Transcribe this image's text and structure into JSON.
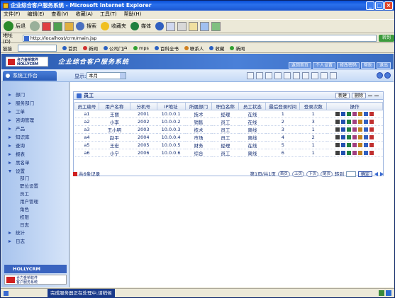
{
  "window": {
    "title": "企业综合客户服务系统 - Microsoft Internet Explorer"
  },
  "menu": [
    "文件(F)",
    "编辑(E)",
    "查看(V)",
    "收藏(A)",
    "工具(T)",
    "帮助(H)"
  ],
  "toolbar": {
    "back": "后退",
    "search": "搜索",
    "favorites": "收藏夹",
    "media": "媒体"
  },
  "address": {
    "label": "地址(D)",
    "value": "http://localhost/crm/main.jsp",
    "go": "转到"
  },
  "links": {
    "label": "链接",
    "items": [
      "首页",
      "新闻",
      "公司门户",
      "mps",
      "百科全书",
      "联系人",
      "收藏",
      "新闻"
    ]
  },
  "app": {
    "logo_line1": "合力金桥软件",
    "logo_line2": "HOLLYCRM",
    "title": "企业综合客户服务系统",
    "header_buttons": [
      "返回首页",
      "个人设置",
      "修改密码",
      "帮助",
      "退出"
    ]
  },
  "subheader": {
    "side_tab": "系统工作台",
    "display_label": "显示:",
    "display_value": "本月"
  },
  "sidebar": {
    "items": [
      {
        "label": "部门",
        "open": false
      },
      {
        "label": "服务部门",
        "open": false
      },
      {
        "label": "工单",
        "open": false
      },
      {
        "label": "咨询管理",
        "open": false
      },
      {
        "label": "产品",
        "open": false
      },
      {
        "label": "知识库",
        "open": false
      },
      {
        "label": "查询",
        "open": false
      },
      {
        "label": "报表",
        "open": false
      },
      {
        "label": "黑名单",
        "open": false
      },
      {
        "label": "设置",
        "open": true
      }
    ],
    "subitems": [
      "部门",
      "职位设置",
      "员工",
      "用户管理",
      "角色",
      "权限",
      "日志"
    ],
    "after_items": [
      {
        "label": "统计",
        "open": false
      },
      {
        "label": "日志",
        "open": false
      }
    ],
    "bottom_logo": "HOLLYCRM",
    "bottom_text1": "合力金桥软件",
    "bottom_text2": "客户服务系统"
  },
  "panel": {
    "title": "员工",
    "buttons": [
      "新建",
      "删除"
    ]
  },
  "table": {
    "columns": [
      "员工编号",
      "用户名称",
      "分机号",
      "IP地址",
      "所属部门",
      "职位名称",
      "员工状态",
      "最后登录时间",
      "登录次数",
      "操作"
    ],
    "rows": [
      [
        "a1",
        "王丽",
        "2001",
        "10.0.0.1",
        "技术",
        "经理",
        "在线",
        "1",
        "1"
      ],
      [
        "a2",
        "小李",
        "2002",
        "10.0.0.2",
        "销售",
        "员工",
        "在线",
        "2",
        "3"
      ],
      [
        "a3",
        "王小明",
        "2003",
        "10.0.0.3",
        "技术",
        "员工",
        "离线",
        "3",
        "1"
      ],
      [
        "a4",
        "赵平",
        "2004",
        "10.0.0.4",
        "市场",
        "员工",
        "离线",
        "4",
        "2"
      ],
      [
        "a5",
        "王宏",
        "2005",
        "10.0.0.5",
        "财务",
        "经理",
        "在线",
        "5",
        "1"
      ],
      [
        "a6",
        "小宁",
        "2006",
        "10.0.0.6",
        "综合",
        "员工",
        "离线",
        "6",
        "1"
      ]
    ]
  },
  "pager": {
    "summary": "共6条记录",
    "page_info": "第1页/共1页",
    "buttons": [
      "首页",
      "上页",
      "下页",
      "尾页"
    ],
    "jump_label": "转到",
    "go": "确定"
  },
  "status": {
    "text": "完成服务器正在处理中,请稍候"
  }
}
